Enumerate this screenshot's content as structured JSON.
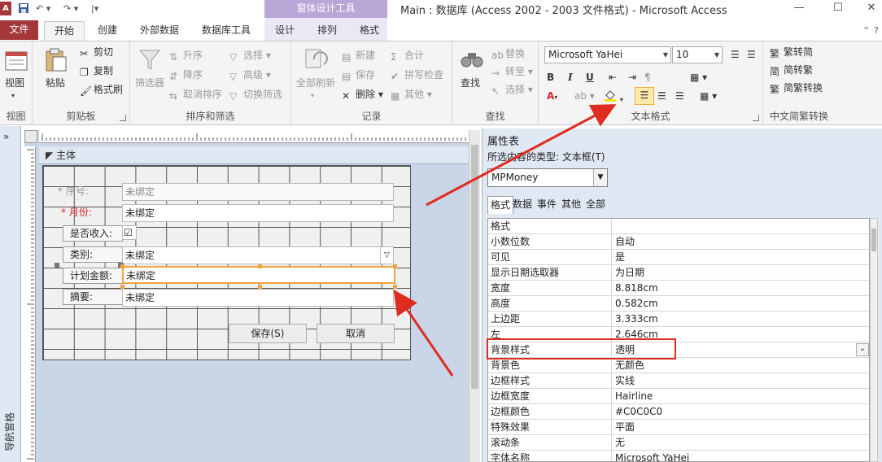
{
  "titlebar": {
    "logo": "A",
    "context_tab": "窗体设计工具",
    "title": "Main : 数据库 (Access 2002 - 2003 文件格式) - Microsoft Access",
    "controls": {
      "minimize": "—",
      "maximize": "☐",
      "close": "✕"
    }
  },
  "tabs": {
    "file": "文件",
    "home": "开始",
    "create": "创建",
    "external": "外部数据",
    "dbtools": "数据库工具",
    "design": "设计",
    "arrange": "排列",
    "format": "格式"
  },
  "ribbon": {
    "view": {
      "label": "视图",
      "group": "视图"
    },
    "clipboard": {
      "paste": "粘贴",
      "cut": "剪切",
      "copy": "复制",
      "painter": "格式刷",
      "group": "剪贴板"
    },
    "sortfilter": {
      "filter": "筛选器",
      "asc": "升序",
      "desc": "降序",
      "clear": "取消排序",
      "select": "选择",
      "advanced": "高级",
      "toggle": "切换筛选",
      "group": "排序和筛选"
    },
    "records": {
      "refresh": "全部刷新",
      "new": "新建",
      "save": "保存",
      "delete": "删除",
      "totals": "合计",
      "spelling": "拼写检查",
      "more": "其他",
      "group": "记录"
    },
    "find": {
      "find": "查找",
      "replace": "替换",
      "goto": "转至",
      "select": "选择",
      "group": "查找"
    },
    "text": {
      "font": "Microsoft YaHei",
      "size": "10",
      "group": "文本格式",
      "bold": "B",
      "italic": "I",
      "underline": "U",
      "fontcolor": "A"
    },
    "chinese": {
      "t2s": "繁转简",
      "s2t": "简转繁",
      "convert": "简繁转换",
      "group": "中文简繁转换"
    }
  },
  "nav": {
    "label": "导航窗格",
    "expand": "»"
  },
  "design": {
    "section": "主体",
    "fields": [
      {
        "label": "* 序号:",
        "value": "未绑定"
      },
      {
        "label": "* 月份:",
        "value": "未绑定"
      },
      {
        "label": "是否收入:",
        "value": "☑"
      },
      {
        "label": "类别:",
        "value": "未绑定"
      },
      {
        "label": "计划金额:",
        "value": "未绑定"
      },
      {
        "label": "摘要:",
        "value": "未绑定"
      }
    ],
    "buttons": {
      "save": "保存(S)",
      "cancel": "取消"
    }
  },
  "propsheet": {
    "title": "属性表",
    "selection_type": "所选内容的类型: 文本框(T)",
    "control": "MPMoney",
    "tabs": [
      "格式",
      "数据",
      "事件",
      "其他",
      "全部"
    ],
    "rows": [
      {
        "name": "格式",
        "value": ""
      },
      {
        "name": "小数位数",
        "value": "自动"
      },
      {
        "name": "可见",
        "value": "是"
      },
      {
        "name": "显示日期选取器",
        "value": "为日期"
      },
      {
        "name": "宽度",
        "value": "8.818cm"
      },
      {
        "name": "高度",
        "value": "0.582cm"
      },
      {
        "name": "上边距",
        "value": "3.333cm"
      },
      {
        "name": "左",
        "value": "2.646cm"
      },
      {
        "name": "背景样式",
        "value": "透明"
      },
      {
        "name": "背景色",
        "value": "无颜色"
      },
      {
        "name": "边框样式",
        "value": "实线"
      },
      {
        "name": "边框宽度",
        "value": "Hairline"
      },
      {
        "name": "边框颜色",
        "value": "#C0C0C0"
      },
      {
        "name": "特殊效果",
        "value": "平面"
      },
      {
        "name": "滚动条",
        "value": "无"
      },
      {
        "name": "字体名称",
        "value": "Microsoft YaHei"
      }
    ]
  },
  "colors": {
    "brand": "#a4373a",
    "context": "#b9a6d6",
    "annotation": "#e02b20",
    "selection": "#f4a340"
  }
}
